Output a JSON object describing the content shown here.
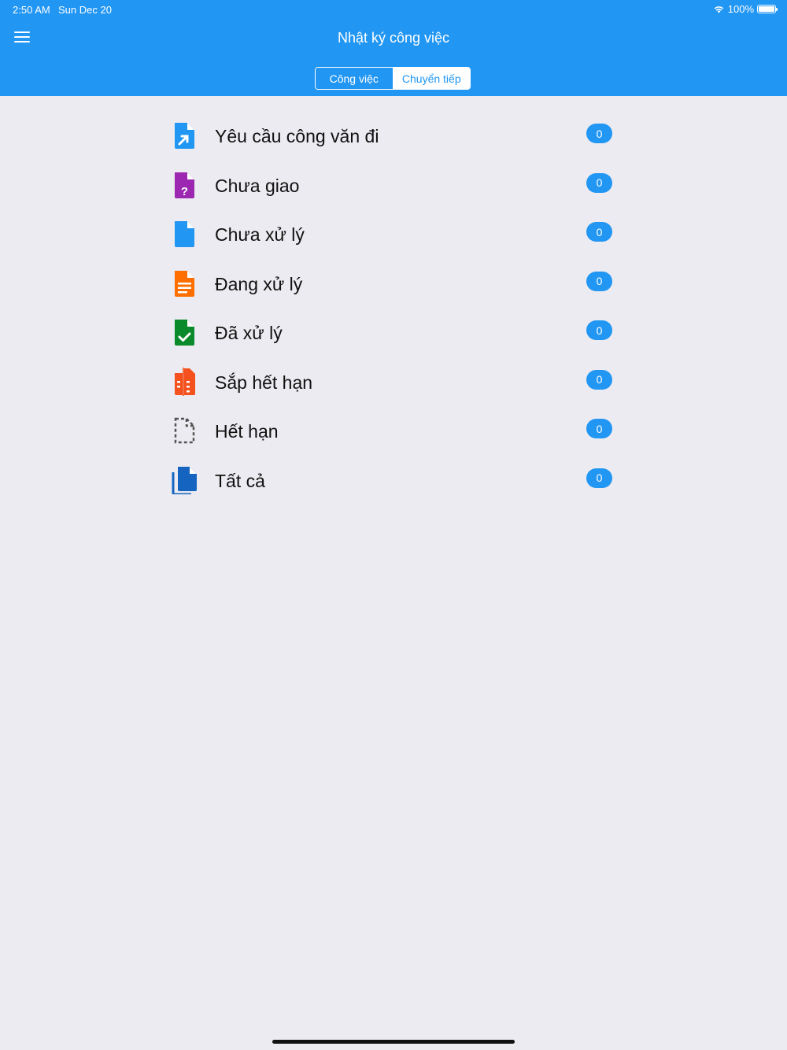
{
  "status_bar": {
    "time": "2:50 AM",
    "date": "Sun Dec 20",
    "battery": "100%"
  },
  "header": {
    "title": "Nhật ký công việc"
  },
  "tabs": [
    {
      "label": "Công việc",
      "active": true
    },
    {
      "label": "Chuyển tiếp",
      "active": false
    }
  ],
  "colors": {
    "primary": "#2196f3",
    "background": "#ebebf1"
  },
  "items": [
    {
      "label": "Yêu cầu công văn đi",
      "count": "0",
      "icon": "document-outgoing-icon",
      "color": "#2196f3"
    },
    {
      "label": "Chưa giao",
      "count": "0",
      "icon": "document-question-icon",
      "color": "#9c27b0"
    },
    {
      "label": "Chưa xử lý",
      "count": "0",
      "icon": "document-icon",
      "color": "#2196f3"
    },
    {
      "label": "Đang xử lý",
      "count": "0",
      "icon": "document-lines-icon",
      "color": "#ff6f00"
    },
    {
      "label": "Đã xử lý",
      "count": "0",
      "icon": "document-check-icon",
      "color": "#0a8a2a"
    },
    {
      "label": "Sắp hết hạn",
      "count": "0",
      "icon": "document-compare-icon",
      "color": "#f4511e"
    },
    {
      "label": "Hết hạn",
      "count": "0",
      "icon": "document-dashed-icon",
      "color": "#555555"
    },
    {
      "label": "Tất cả",
      "count": "0",
      "icon": "documents-copy-icon",
      "color": "#1565c0"
    }
  ]
}
